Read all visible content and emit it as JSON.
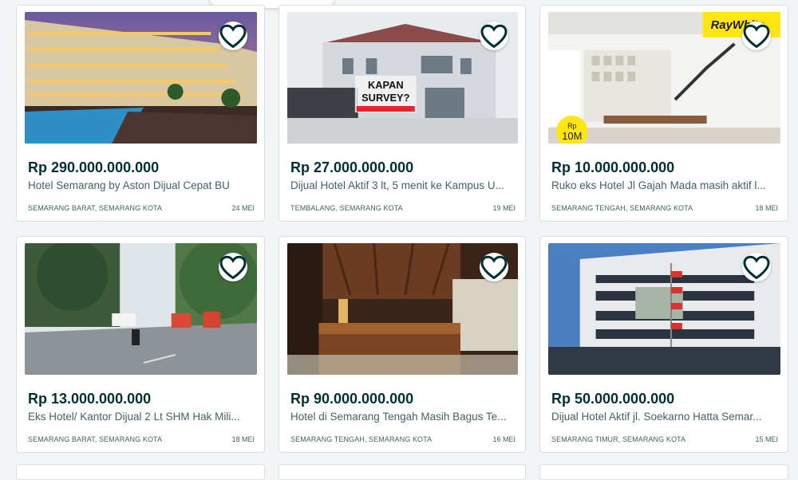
{
  "listings": [
    {
      "price": "Rp 290.000.000.000",
      "title": "Hotel Semarang by Aston Dijual Cepat BU",
      "location": "SEMARANG BARAT, SEMARANG KOTA",
      "date": "24 MEI"
    },
    {
      "price": "Rp 27.000.000.000",
      "title": "Dijual Hotel Aktif 3 lt, 5 menit ke Kampus U...",
      "location": "TEMBALANG, SEMARANG KOTA",
      "date": "19 MEI",
      "image_text": [
        "KAPAN",
        "SURVEY?"
      ]
    },
    {
      "price": "Rp 10.000.000.000",
      "title": "Ruko eks Hotel Jl Gajah Mada masih aktif l...",
      "location": "SEMARANG TENGAH, SEMARANG KOTA",
      "date": "18 MEI",
      "image_text": [
        "RayWhite",
        "Rp",
        "10M"
      ]
    },
    {
      "price": "Rp 13.000.000.000",
      "title": "Eks Hotel/ Kantor Dijual 2 Lt SHM Hak Mili...",
      "location": "SEMARANG BARAT, SEMARANG KOTA",
      "date": "18 MEI"
    },
    {
      "price": "Rp 90.000.000.000",
      "title": "Hotel di Semarang Tengah Masih Bagus Te...",
      "location": "SEMARANG TENGAH, SEMARANG KOTA",
      "date": "16 MEI"
    },
    {
      "price": "Rp 50.000.000.000",
      "title": "Dijual Hotel Aktif jl. Soekarno Hatta Semar...",
      "location": "SEMARANG TIMUR, SEMARANG KOTA",
      "date": "15 MEI"
    }
  ],
  "icons": {
    "favorite": "heart-outline-icon"
  },
  "colors": {
    "text": "#002f34",
    "muted": "#406367",
    "border": "#d8dfe0",
    "background": "#f2f4f5",
    "raywhite": "#ffe512"
  }
}
